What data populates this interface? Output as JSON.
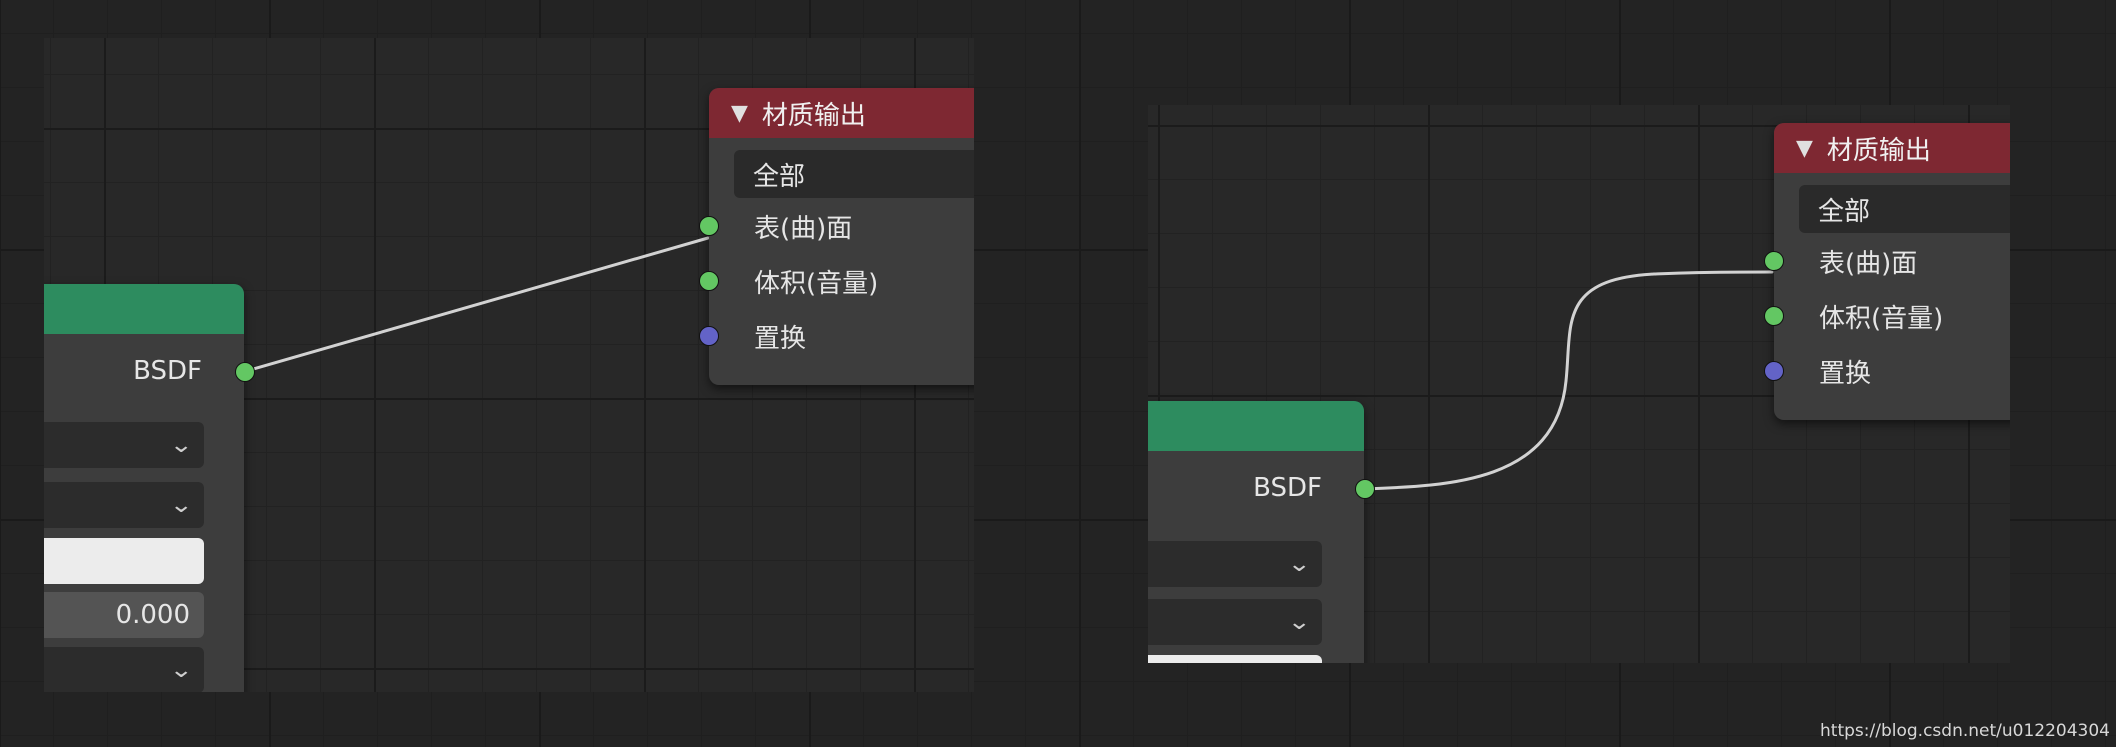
{
  "left_view": {
    "output_node": {
      "title": "材质输出",
      "target": "全部",
      "sockets": [
        {
          "label": "表(曲)面",
          "type": "shader"
        },
        {
          "label": "体积(音量)",
          "type": "shader"
        },
        {
          "label": "置换",
          "type": "vector"
        }
      ]
    },
    "bsdf_node": {
      "output_label": "BSDF",
      "value_field": "0.000"
    }
  },
  "right_view": {
    "output_node": {
      "title": "材质输出",
      "target": "全部",
      "sockets": [
        {
          "label": "表(曲)面",
          "type": "shader"
        },
        {
          "label": "体积(音量)",
          "type": "shader"
        },
        {
          "label": "置换",
          "type": "vector"
        }
      ]
    },
    "bsdf_node": {
      "output_label": "BSDF"
    }
  },
  "icons": {
    "collapse": "triangle-down-icon",
    "dropdown": "chevron-down-icon"
  },
  "colors": {
    "output_header": "#7e2832",
    "bsdf_header": "#2d8c5f",
    "shader_socket": "#63c763",
    "vector_socket": "#6363c7"
  },
  "watermark": "https://blog.csdn.net/u012204304"
}
